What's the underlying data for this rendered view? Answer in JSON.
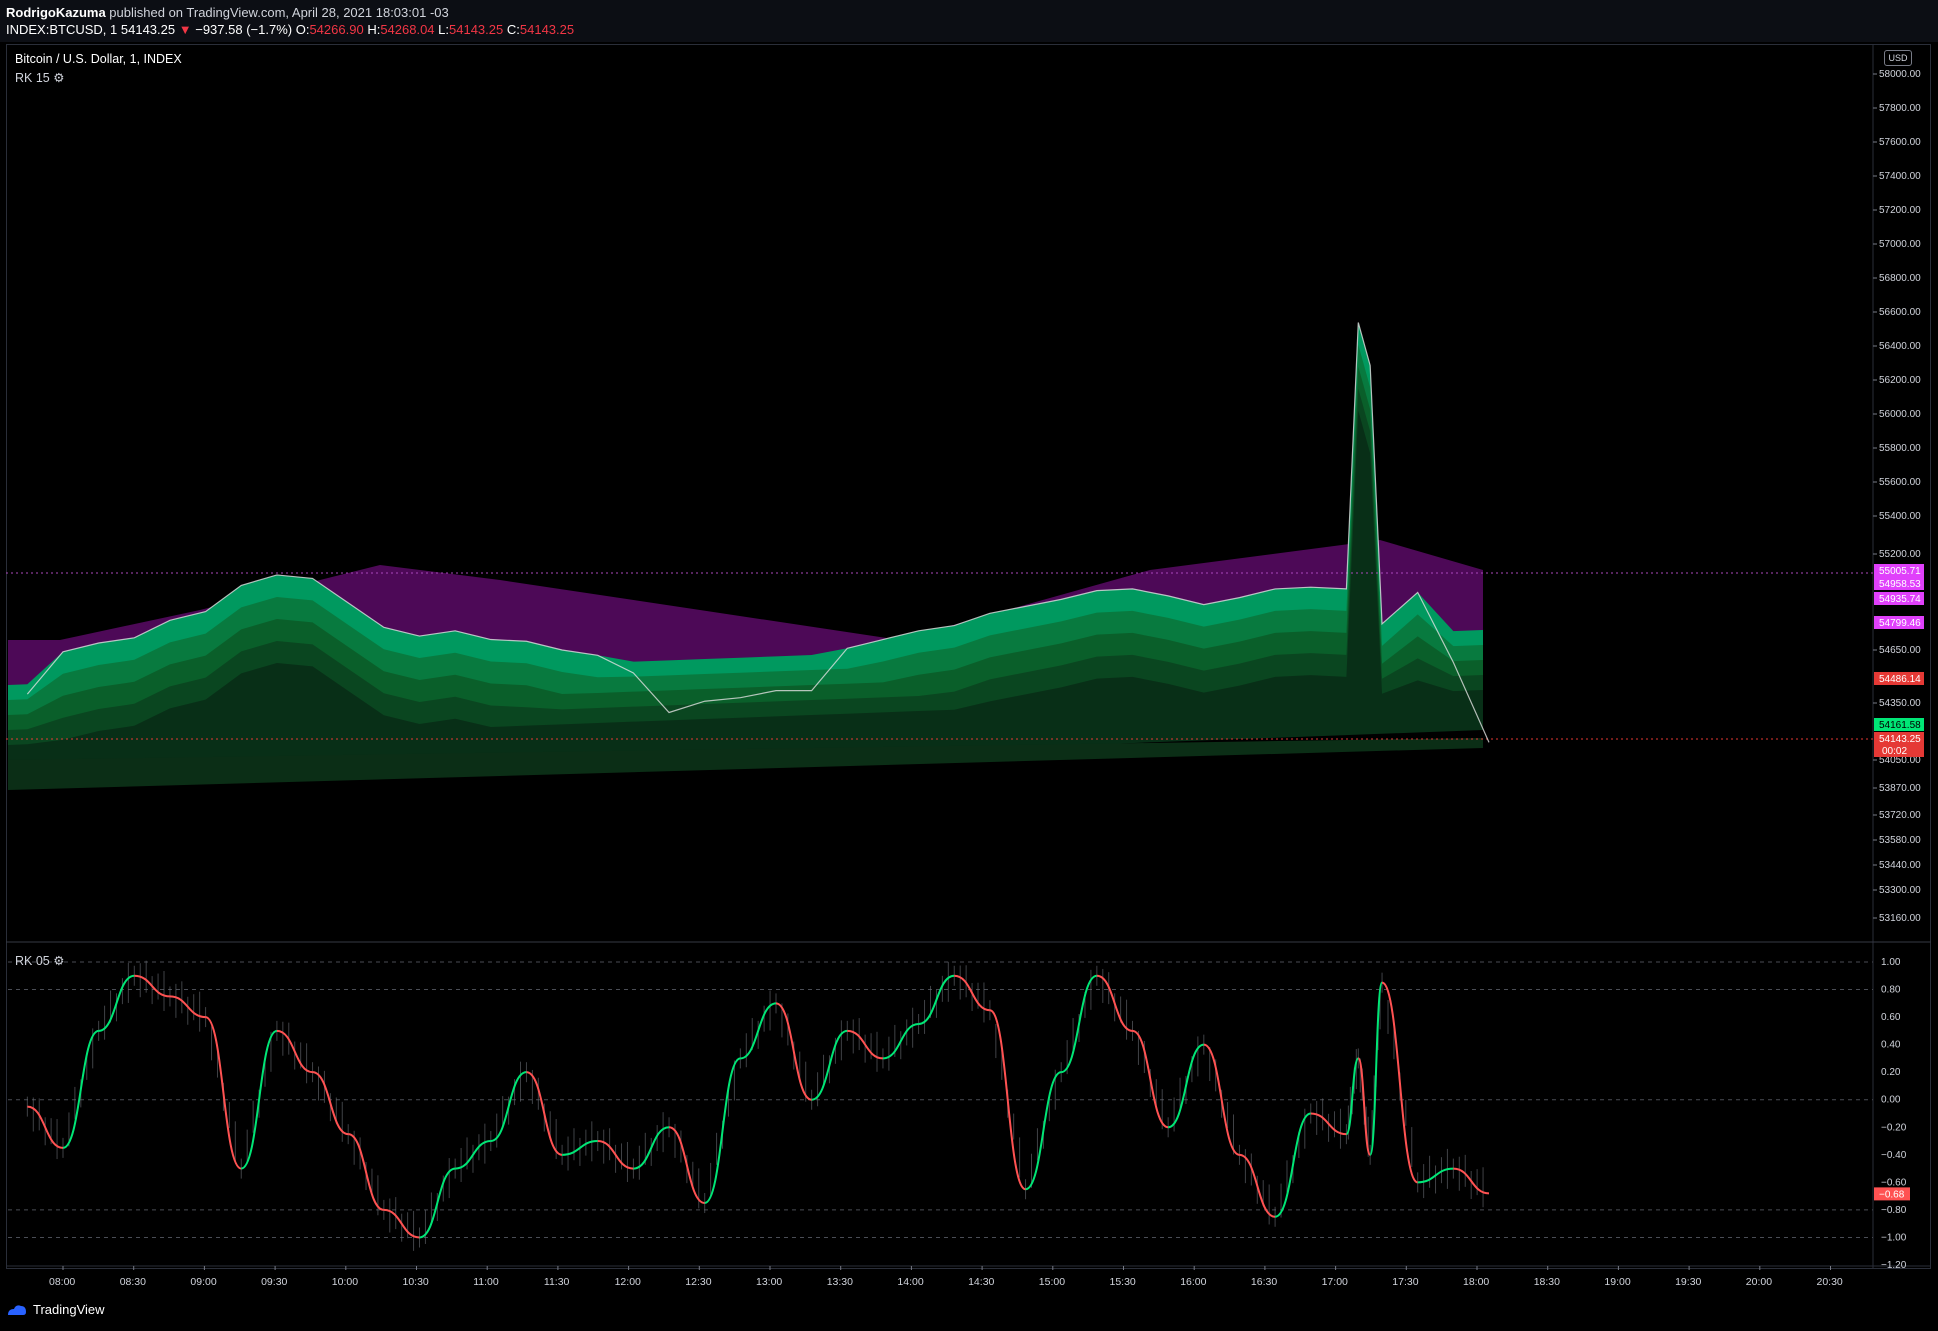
{
  "header": {
    "author": "RodrigoKazuma",
    "published_text": "published on TradingView.com, April 28, 2021 18:03:01 -03",
    "symbol": "INDEX:BTCUSD, 1",
    "last": "54143.25",
    "change_arrow": "▼",
    "change": "−937.58 (−1.7%)",
    "ohlc": [
      {
        "k": "O:",
        "v": "54266.90"
      },
      {
        "k": "H:",
        "v": "54268.04"
      },
      {
        "k": "L:",
        "v": "54143.25"
      },
      {
        "k": "C:",
        "v": "54143.25"
      }
    ]
  },
  "chart": {
    "title": "Bitcoin / U.S. Dollar, 1, INDEX",
    "indicator_main": "RK 15",
    "indicator_sub": "RK 05",
    "currency": "USD",
    "price_ticks": [
      "58000.00",
      "57800.00",
      "57600.00",
      "57400.00",
      "57200.00",
      "57000.00",
      "56800.00",
      "56600.00",
      "56400.00",
      "56200.00",
      "56000.00",
      "55800.00",
      "55600.00",
      "55400.00",
      "55200.00",
      "54650.00",
      "54350.00",
      "54050.00",
      "53870.00",
      "53720.00",
      "53580.00",
      "53440.00",
      "53300.00",
      "53160.00"
    ],
    "price_labels": [
      {
        "text": "55005.71",
        "color": "#e040fb"
      },
      {
        "text": "54958.53",
        "color": "#e040fb"
      },
      {
        "text": "54935.74",
        "color": "#e040fb"
      },
      {
        "text": "54799.46",
        "color": "#e040fb"
      },
      {
        "text": "54486.14",
        "color": "#e53935"
      },
      {
        "text": "54161.58",
        "color": "#00e676"
      },
      {
        "text": "54143.25",
        "color": "#e53935"
      }
    ],
    "countdown": "00:02",
    "osc_ticks": [
      "1.00",
      "0.80",
      "0.60",
      "0.40",
      "0.20",
      "0.00",
      "−0.20",
      "−0.40",
      "−0.60",
      "−0.80",
      "−1.00",
      "−1.20"
    ],
    "osc_label": "−0.68",
    "time_ticks": [
      "08:00",
      "08:30",
      "09:00",
      "09:30",
      "10:00",
      "10:30",
      "11:00",
      "11:30",
      "12:00",
      "12:30",
      "13:00",
      "13:30",
      "14:00",
      "14:30",
      "15:00",
      "15:30",
      "16:00",
      "16:30",
      "17:00",
      "17:30",
      "18:00",
      "18:30",
      "19:00",
      "19:30",
      "20:00",
      "20:30"
    ],
    "colors": {
      "bull": "#00b074",
      "bear": "#8b0094",
      "osc_up": "#00e676",
      "osc_down": "#ff5252"
    }
  },
  "footer": {
    "brand": "TradingView"
  },
  "chart_data": {
    "type": "line",
    "x": [
      "07:45",
      "08:00",
      "08:15",
      "08:30",
      "08:45",
      "09:00",
      "09:15",
      "09:30",
      "09:45",
      "10:00",
      "10:15",
      "10:30",
      "10:45",
      "11:00",
      "11:15",
      "11:30",
      "11:45",
      "12:00",
      "12:15",
      "12:30",
      "12:45",
      "13:00",
      "13:15",
      "13:30",
      "13:45",
      "14:00",
      "14:15",
      "14:30",
      "14:45",
      "15:00",
      "15:15",
      "15:30",
      "15:45",
      "16:00",
      "16:15",
      "16:30",
      "16:45",
      "17:00",
      "17:05",
      "17:10",
      "17:15",
      "17:30",
      "17:45",
      "18:00"
    ],
    "series": [
      {
        "values": [
          54400,
          54640,
          54690,
          54720,
          54820,
          54870,
          55020,
          55080,
          55060,
          54920,
          54780,
          54730,
          54760,
          54710,
          54700,
          54650,
          54620,
          54520,
          54300,
          54360,
          54380,
          54420,
          54420,
          54660,
          54710,
          54760,
          54790,
          54860,
          54900,
          54940,
          54990,
          55000,
          54960,
          54910,
          54950,
          55000,
          55010,
          55000,
          56550,
          56300,
          54800,
          54980,
          54580,
          54143
        ]
      }
    ],
    "ylim": [
      53080,
      58100
    ],
    "oscillator": {
      "name": "RK 05",
      "ylim": [
        -1.2,
        1.0
      ],
      "values": [
        -0.05,
        -0.35,
        0.5,
        0.9,
        0.75,
        0.6,
        -0.5,
        0.5,
        0.2,
        -0.25,
        -0.8,
        -1.0,
        -0.5,
        -0.3,
        0.2,
        -0.4,
        -0.3,
        -0.5,
        -0.2,
        -0.75,
        0.3,
        0.7,
        0.0,
        0.5,
        0.3,
        0.55,
        0.9,
        0.65,
        -0.65,
        0.2,
        0.9,
        0.5,
        -0.2,
        0.4,
        -0.4,
        -0.85,
        -0.1,
        -0.25,
        0.3,
        -0.4,
        0.85,
        -0.6,
        -0.5,
        -0.68
      ]
    }
  }
}
